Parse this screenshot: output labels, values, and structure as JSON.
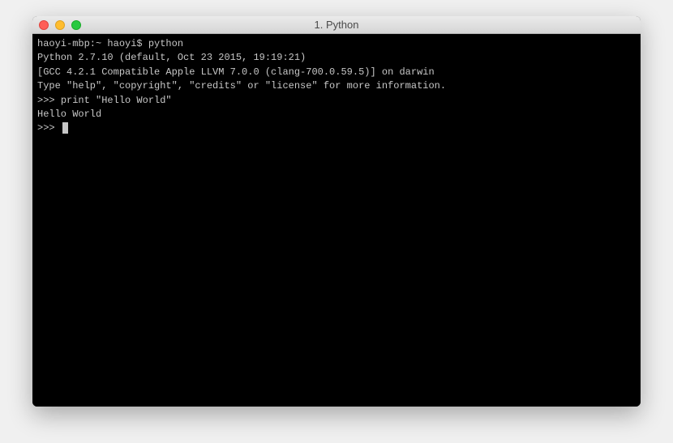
{
  "window": {
    "title": "1. Python"
  },
  "terminal": {
    "shell_prompt": "haoyi-mbp:~ haoyi$ ",
    "shell_command": "python",
    "lines": {
      "l1": "Python 2.7.10 (default, Oct 23 2015, 19:19:21)",
      "l2": "[GCC 4.2.1 Compatible Apple LLVM 7.0.0 (clang-700.0.59.5)] on darwin",
      "l3": "Type \"help\", \"copyright\", \"credits\" or \"license\" for more information."
    },
    "repl_prompt1": ">>> ",
    "repl_input1": "print \"Hello World\"",
    "repl_output1": "Hello World",
    "repl_prompt2": ">>> "
  }
}
